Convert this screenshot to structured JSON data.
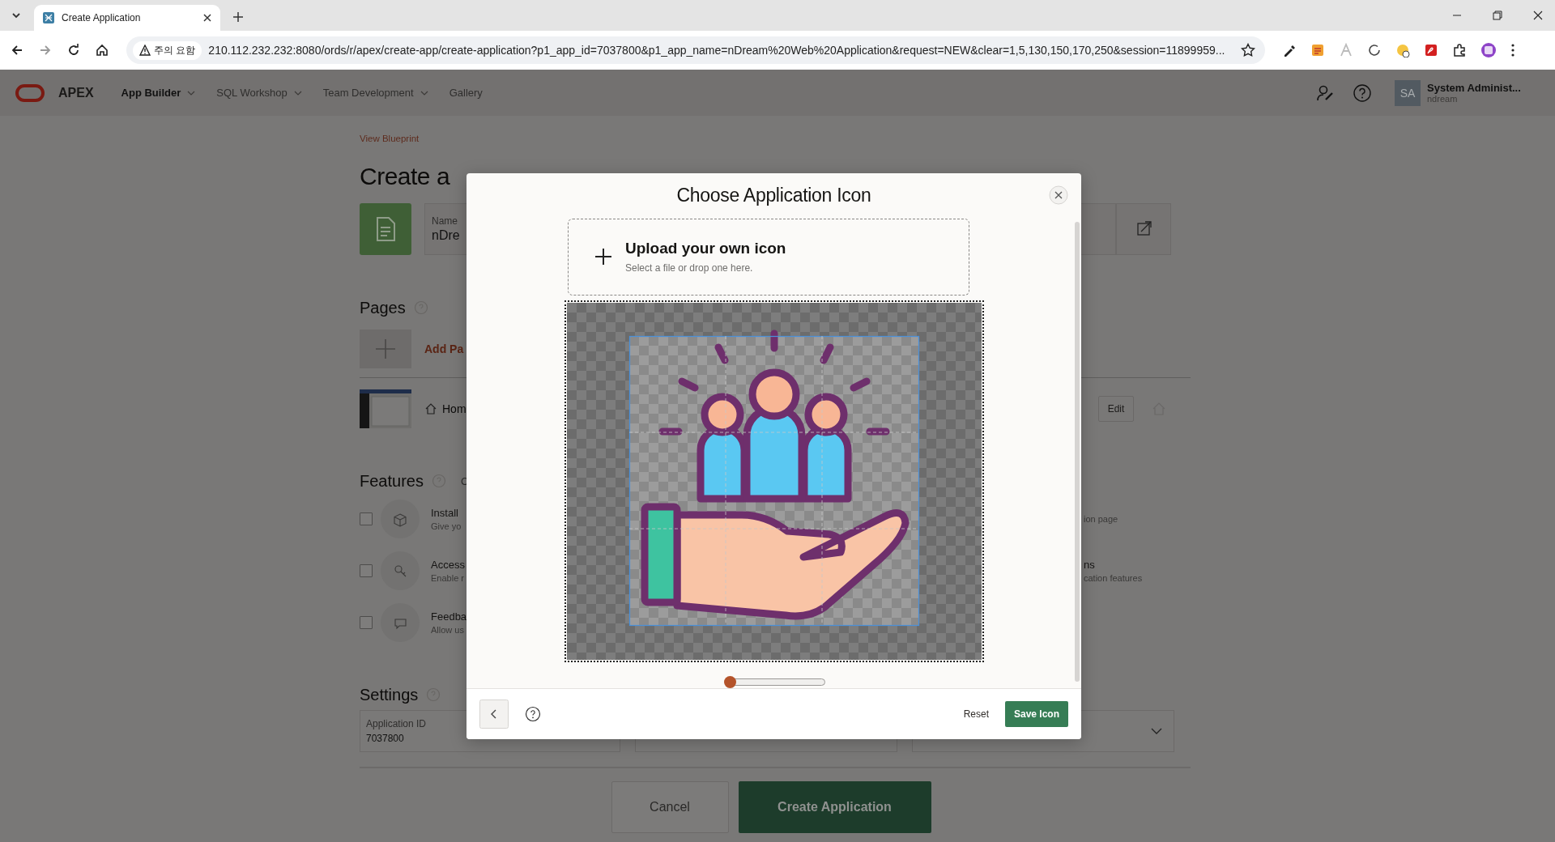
{
  "browser": {
    "tabs": [
      {
        "title": "Create Application",
        "selected": true
      }
    ],
    "address": {
      "warning": "주의 요함",
      "url": "210.112.232.232:8080/ords/r/apex/create-app/create-application?p1_app_id=7037800&p1_app_name=nDream%20Web%20Application&request=NEW&clear=1,5,130,150,170,250&session=11899959..."
    }
  },
  "header": {
    "product": "APEX",
    "nav": [
      {
        "label": "App Builder",
        "selected": true,
        "dropdown": true
      },
      {
        "label": "SQL Workshop",
        "selected": false,
        "dropdown": true
      },
      {
        "label": "Team Development",
        "selected": false,
        "dropdown": true
      },
      {
        "label": "Gallery",
        "selected": false,
        "dropdown": false
      }
    ],
    "user": {
      "initials": "SA",
      "name": "System Administ...",
      "workspace": "ndream"
    }
  },
  "page": {
    "breadcrumb": "View Blueprint",
    "title": "Create a",
    "name_field": {
      "label": "Name",
      "value": "nDre"
    },
    "pages": {
      "heading": "Pages",
      "add_label": "Add Pa",
      "rows": [
        {
          "label": "Hom",
          "edit": "Edit"
        }
      ]
    },
    "features": {
      "heading": "Features",
      "note": "C",
      "items": [
        {
          "title": "Install",
          "description": "Give yo",
          "checked": false,
          "right_description": "ion page"
        },
        {
          "title": "Access",
          "description": "Enable r",
          "checked": false,
          "right_title": "ns",
          "right_description": "cation features"
        },
        {
          "title": "Feedba",
          "description": "Allow us",
          "checked": false
        }
      ]
    },
    "settings": {
      "heading": "Settings",
      "fields": [
        {
          "label": "Application ID",
          "value": "7037800"
        }
      ]
    },
    "buttons": [
      {
        "label": "Cancel",
        "kind": "secondary"
      },
      {
        "label": "Create Application",
        "kind": "primary"
      }
    ]
  },
  "dialog": {
    "title": "Choose Application Icon",
    "upload": {
      "title": "Upload your own icon",
      "hint": "Select a file or drop one here."
    },
    "zoom": {
      "level": 0
    },
    "footer": {
      "reset": "Reset",
      "save": "Save Icon"
    }
  }
}
